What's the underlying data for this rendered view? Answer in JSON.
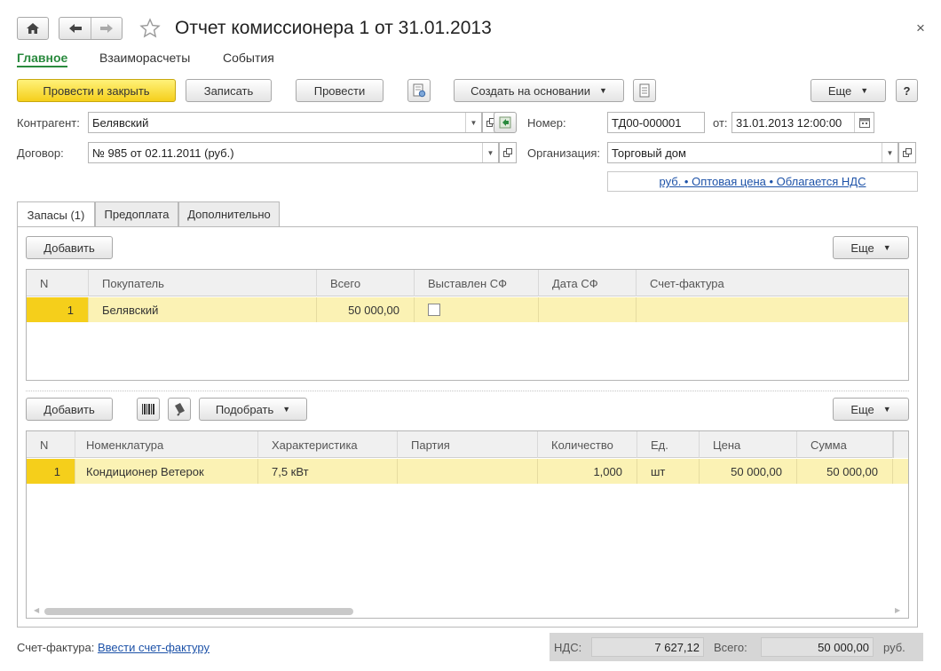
{
  "window": {
    "title": "Отчет комиссионера 1 от 31.01.2013",
    "close": "×"
  },
  "nav": {
    "main": "Главное",
    "settlements": "Взаиморасчеты",
    "events": "События"
  },
  "toolbar": {
    "post_close": "Провести и закрыть",
    "save": "Записать",
    "post": "Провести",
    "create_based": "Создать на основании",
    "more": "Еще",
    "help": "?"
  },
  "form": {
    "counterparty_label": "Контрагент:",
    "counterparty_value": "Белявский",
    "contract_label": "Договор:",
    "contract_value": "№ 985 от 02.11.2011 (руб.)",
    "number_label": "Номер:",
    "number_value": "ТД00-000001",
    "date_label": "от:",
    "date_value": "31.01.2013 12:00:00",
    "org_label": "Организация:",
    "org_value": "Торговый дом",
    "price_link": "руб. • Оптовая цена • Облагается НДС"
  },
  "tabs": [
    "Запасы (1)",
    "Предоплата",
    "Дополнительно"
  ],
  "buyers_toolbar": {
    "add": "Добавить",
    "more": "Еще"
  },
  "buyers_table": {
    "headers": [
      "N",
      "Покупатель",
      "Всего",
      "Выставлен СФ",
      "Дата СФ",
      "Счет-фактура"
    ],
    "rows": [
      {
        "n": "1",
        "buyer": "Белявский",
        "total": "50 000,00",
        "invoiced": false,
        "inv_date": "",
        "invoice": ""
      }
    ]
  },
  "goods_toolbar": {
    "add": "Добавить",
    "pick": "Подобрать",
    "more": "Еще"
  },
  "goods_table": {
    "headers": [
      "N",
      "Номенклатура",
      "Характеристика",
      "Партия",
      "Количество",
      "Ед.",
      "Цена",
      "Сумма"
    ],
    "rows": [
      {
        "n": "1",
        "item": "Кондиционер Ветерок",
        "char": "7,5 кВт",
        "batch": "",
        "qty": "1,000",
        "unit": "шт",
        "price": "50 000,00",
        "sum": "50 000,00"
      }
    ]
  },
  "footer": {
    "invoice_label": "Счет-фактура:",
    "invoice_link": "Ввести счет-фактуру",
    "vat_label": "НДС:",
    "vat_value": "7 627,12",
    "total_label": "Всего:",
    "total_value": "50 000,00",
    "currency": "руб."
  },
  "colors": {
    "accent_green": "#2a8a3e",
    "row_highlight": "#fbf2b4",
    "primary_button": "#f5cf1b",
    "link": "#1d52a8"
  }
}
